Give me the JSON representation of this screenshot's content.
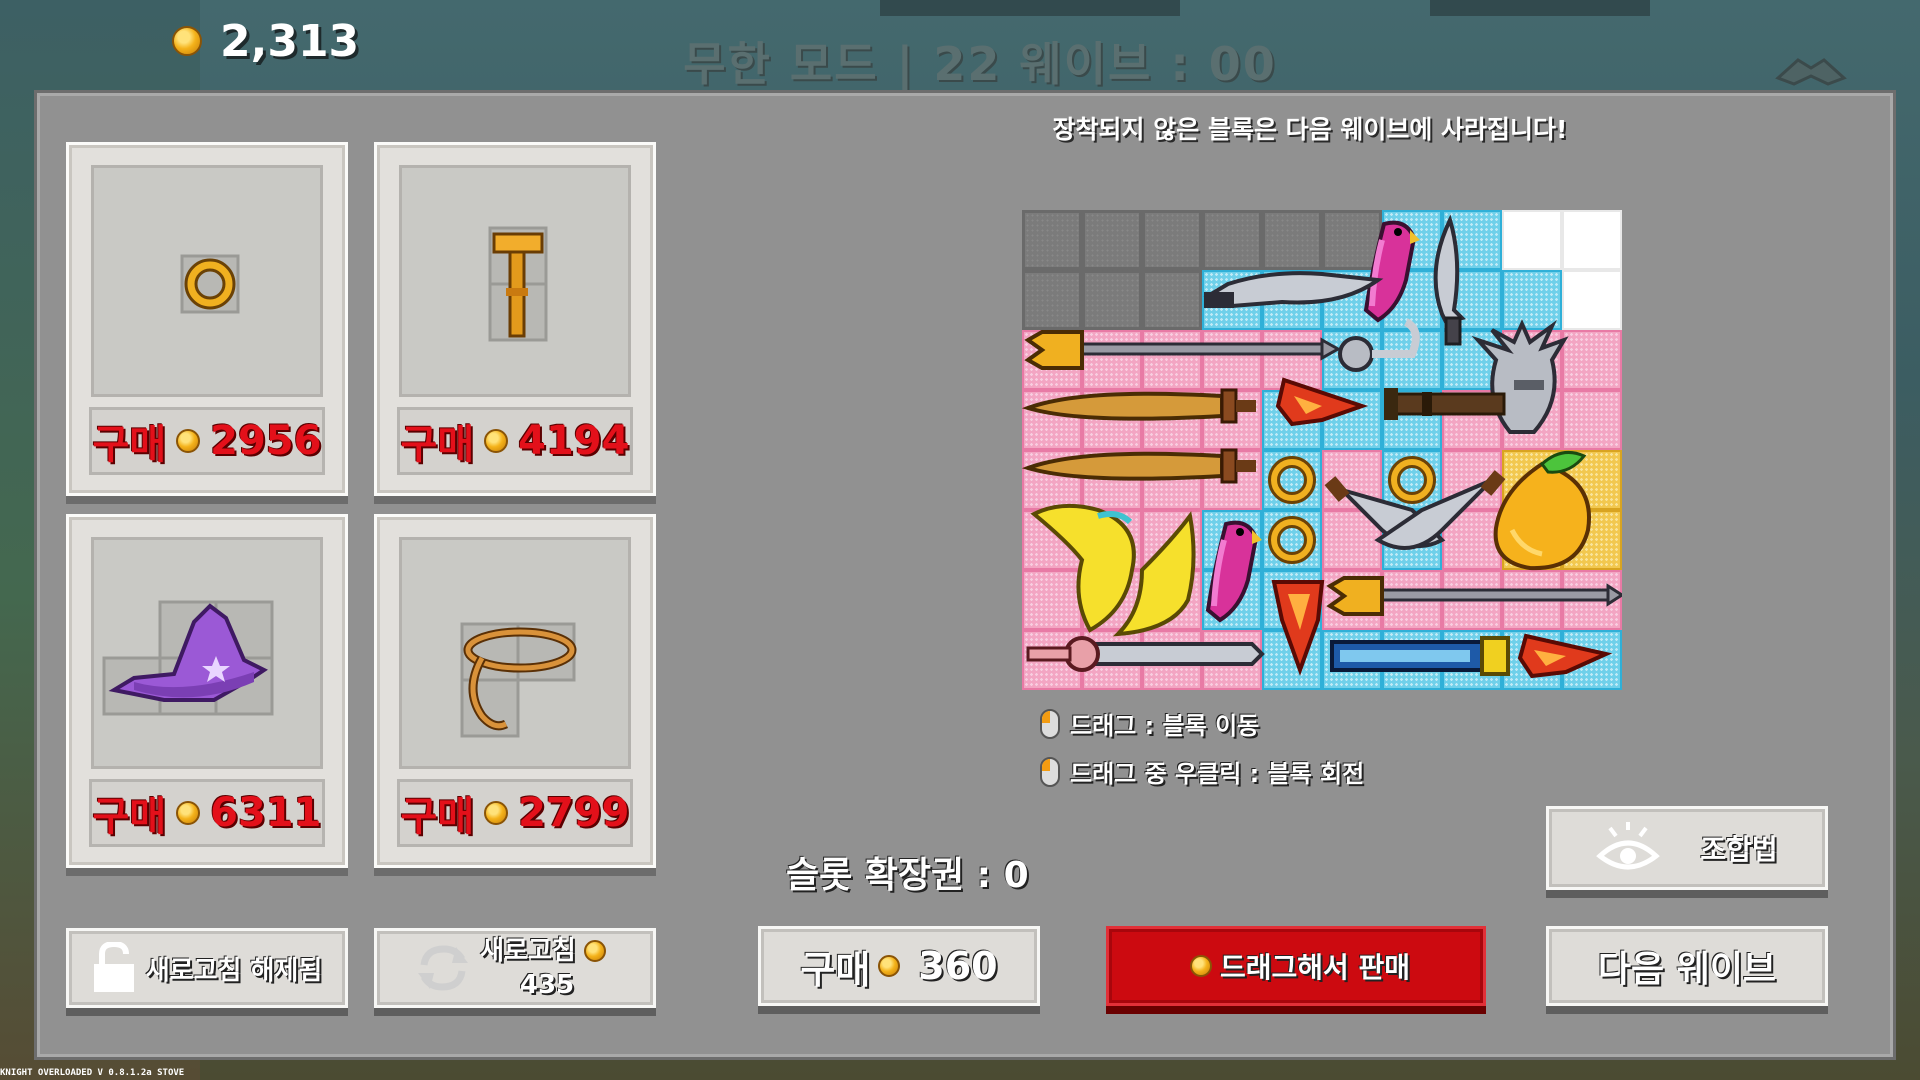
{
  "hud": {
    "gold": "2,313",
    "wave_title": "무한 모드 | 22 웨이브 : 00"
  },
  "notice": "장착되지 않은 블록은 다음 웨이브에 사라집니다!",
  "shop": [
    {
      "item": "ring-icon",
      "buy_label": "구매",
      "price": "2956"
    },
    {
      "item": "hammer-icon",
      "buy_label": "구매",
      "price": "4194"
    },
    {
      "item": "wizard-hat-icon",
      "buy_label": "구매",
      "price": "6311"
    },
    {
      "item": "rope-icon",
      "buy_label": "구매",
      "price": "2799"
    }
  ],
  "buttons": {
    "refresh_unlocked": "새로고침 해제됨",
    "refresh_label": "새로고침",
    "refresh_price": "435",
    "buy_label": "구매",
    "buy_price": "360",
    "drag_sell": "드래그해서 판매",
    "recipe": "조합법",
    "next_wave": "다음 웨이브"
  },
  "slot_expansion": "슬롯 확장권 : 0",
  "hints": [
    "드래그 : 블록 이동",
    "드래그 중 우클릭 : 블록 회전"
  ],
  "version": "KNIGHT OVERLOADED V 0.8.1.2a STOVE",
  "colors": {
    "price_red": "#e3101a",
    "sell_red": "#cc0a10",
    "panel": "#919191",
    "pink_cell": "#f3a5c3",
    "cyan_cell": "#6fd0ea"
  }
}
